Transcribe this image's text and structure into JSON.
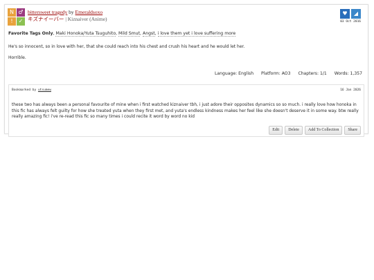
{
  "required_tags": {
    "rating": "N",
    "category": "♂",
    "warning": "!",
    "complete": "✓"
  },
  "work": {
    "title": "bittersweet tragedy",
    "by": "by",
    "author": "Emeraldsoxo",
    "fandom_jp": "キズナイーバー",
    "fandom_sep": "|",
    "fandom_en": "Kiznaiver (Anime)",
    "date": "03 Oct 2016"
  },
  "icons": {
    "heart": "♥",
    "corner": "◢"
  },
  "tags": {
    "label": "Favorite Tags Only",
    "items": [
      "Maki Honoka/Yuta Tsuguhito",
      "Mild Smut",
      "Angst",
      "i love them yet i love suffering more"
    ]
  },
  "summary": [
    "He's so innocent, so in love with her, that she could reach into his chest and crush his heart and he would let her.",
    "Horrible."
  ],
  "stats": {
    "language_label": "Language:",
    "language": "English",
    "platform_label": "Platform:",
    "platform": "AO3",
    "chapters_label": "Chapters:",
    "chapters": "1/1",
    "words_label": "Words:",
    "words": "1,357"
  },
  "bookmark": {
    "by_label": "Bookmarked by",
    "user": "utsumew",
    "date": "16 Jan 2026",
    "note": "these two has always been a personal favourite of mine when i first watched kiznaiver tbh, i just adore their opposites dynamics so so much. i really love how honoka in this fic has always felt guilty for how she treated yuta when they first met, and yuta's endless kindness makes her feel like she doesn't deserve it in some way. btw really really amazing fic! i've re-read this fic so many times i could recite it word by word no kid"
  },
  "actions": {
    "edit": "Edit",
    "delete": "Delete",
    "add_to_collection": "Add To Collection",
    "share": "Share"
  }
}
